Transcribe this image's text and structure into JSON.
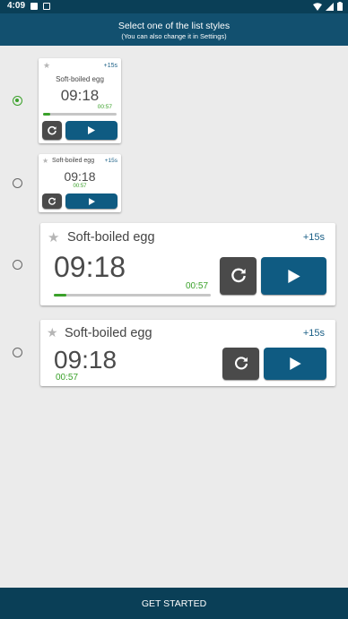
{
  "status_bar": {
    "time": "4:09"
  },
  "header": {
    "title": "Select one of the list styles",
    "subtitle": "(You can also change it in Settings)"
  },
  "styles": [
    {
      "selected": true,
      "title": "Soft-boiled egg",
      "plus": "+15s",
      "time": "09:18",
      "remaining": "00:57",
      "progress": 0.1
    },
    {
      "selected": false,
      "title": "Soft-boiled egg",
      "plus": "+15s",
      "time": "09:18",
      "remaining": "00:57"
    },
    {
      "selected": false,
      "title": "Soft-boiled egg",
      "plus": "+15s",
      "time": "09:18",
      "remaining": "00:57",
      "progress": 0.08
    },
    {
      "selected": false,
      "title": "Soft-boiled egg",
      "plus": "+15s",
      "time": "09:18",
      "remaining": "00:57"
    }
  ],
  "bottom_button": {
    "label": "GET STARTED"
  },
  "colors": {
    "primary": "#12506f",
    "dark": "#0a3f57",
    "accent": "#3aa12a",
    "play": "#0f5b82"
  },
  "icons": [
    "star-icon",
    "reset-icon",
    "play-icon",
    "wifi-icon",
    "signal-icon",
    "battery-icon"
  ]
}
